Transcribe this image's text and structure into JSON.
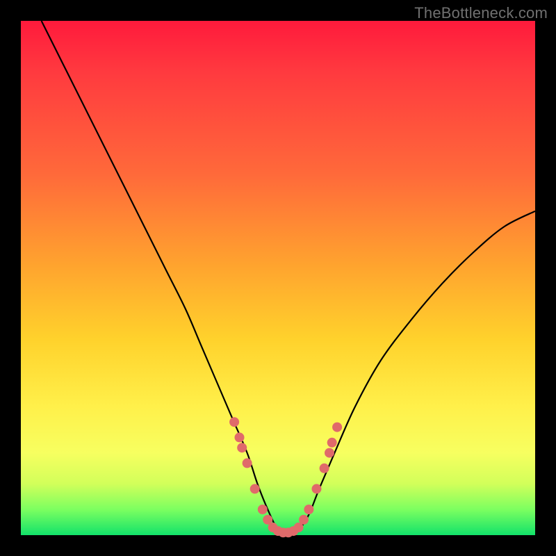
{
  "watermark": "TheBottleneck.com",
  "chart_data": {
    "type": "line",
    "title": "",
    "xlabel": "",
    "ylabel": "",
    "ylim": [
      0,
      100
    ],
    "xlim": [
      0,
      100
    ],
    "series": [
      {
        "name": "bottleneck-curve",
        "x": [
          4,
          8,
          12,
          16,
          20,
          24,
          28,
          32,
          35,
          38,
          41,
          44,
          46,
          48,
          50,
          52,
          54,
          56,
          58,
          61,
          65,
          70,
          76,
          82,
          88,
          94,
          100
        ],
        "y": [
          100,
          92,
          84,
          76,
          68,
          60,
          52,
          44,
          37,
          30,
          23,
          16,
          10,
          5,
          1,
          0,
          1,
          4,
          9,
          16,
          25,
          34,
          42,
          49,
          55,
          60,
          63
        ]
      }
    ],
    "markers": {
      "name": "highlight-dots",
      "color": "#e06a6a",
      "x": [
        41.5,
        42.5,
        43,
        44,
        45.5,
        47,
        48,
        49,
        50,
        51,
        52,
        53,
        54,
        55,
        56,
        57.5,
        59,
        60,
        60.5,
        61.5
      ],
      "y": [
        22,
        19,
        17,
        14,
        9,
        5,
        3,
        1.5,
        0.8,
        0.5,
        0.5,
        0.8,
        1.5,
        3,
        5,
        9,
        13,
        16,
        18,
        21
      ]
    }
  }
}
